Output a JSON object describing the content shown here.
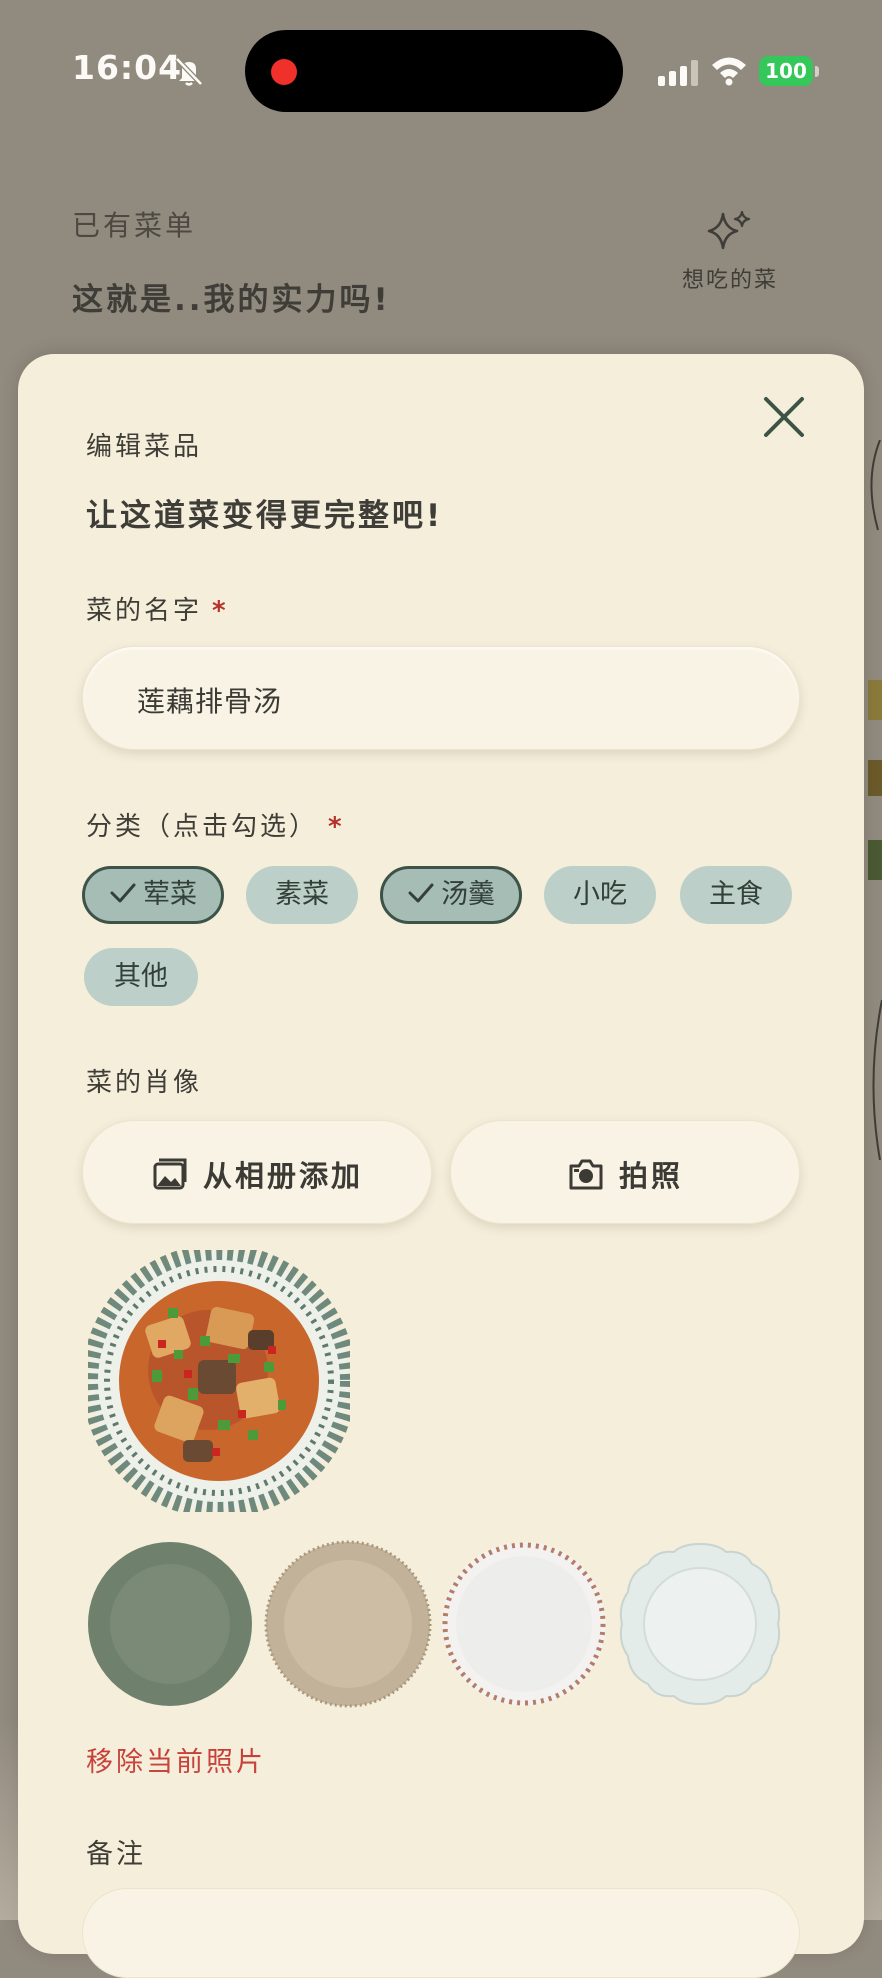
{
  "status_bar": {
    "time": "16:04",
    "battery": "100"
  },
  "header": {
    "subtitle": "已有菜单",
    "title": "这就是..我的实力吗!",
    "wish_label": "想吃的菜"
  },
  "sheet": {
    "subtitle": "编辑菜品",
    "title": "让这道菜变得更完整吧!",
    "name_label": "菜的名字",
    "required_mark": "*",
    "name_value": "莲藕排骨汤",
    "category_label": "分类（点击勾选）",
    "categories": [
      {
        "label": "荤菜",
        "selected": true
      },
      {
        "label": "素菜",
        "selected": false
      },
      {
        "label": "汤羹",
        "selected": true
      },
      {
        "label": "小吃",
        "selected": false
      },
      {
        "label": "主食",
        "selected": false
      },
      {
        "label": "其他",
        "selected": false
      }
    ],
    "portrait_label": "菜的肖像",
    "album_button": "从相册添加",
    "camera_button": "拍照",
    "plate_styles": [
      "sage-green",
      "beige-textured",
      "white-dotted-rim",
      "white-scalloped"
    ],
    "remove_photo": "移除当前照片",
    "notes_label": "备注"
  },
  "icons": {
    "status": [
      "bell-slash-icon",
      "signal-icon",
      "wifi-icon"
    ],
    "header": "sparkle-icon",
    "close": "close-icon",
    "album": "gallery-icon",
    "camera": "camera-icon",
    "check": "check-icon"
  },
  "colors": {
    "background": "#918a7e",
    "sheet": "#f4eedb",
    "chip": "#bccfc8",
    "chip_selected_border": "#3e5348",
    "danger": "#c4352e",
    "accent_text": "#3f3d37"
  }
}
